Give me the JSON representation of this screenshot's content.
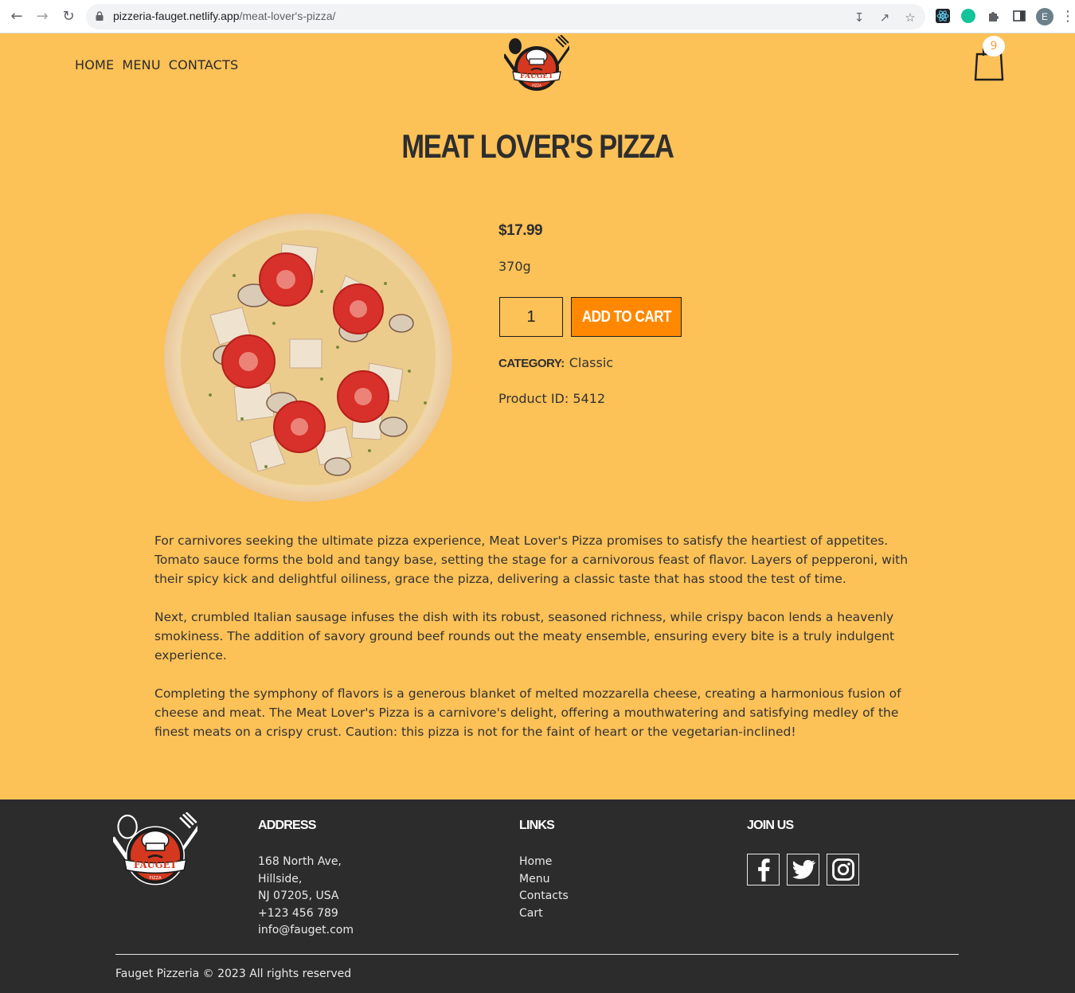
{
  "browser": {
    "url_host": "pizzeria-fauget.netlify.app",
    "url_path": "/meat-lover's-pizza/",
    "profile_initial": "E"
  },
  "nav": {
    "items": [
      {
        "label": "HOME"
      },
      {
        "label": "MENU"
      },
      {
        "label": "CONTACTS"
      }
    ]
  },
  "logo": {
    "brand_text": "FAUGET",
    "sub_text": "PIZZA"
  },
  "cart": {
    "count": "9"
  },
  "product": {
    "title": "MEAT LOVER'S PIZZA",
    "price": "$17.99",
    "weight": "370g",
    "quantity": "1",
    "add_to_cart_label": "ADD TO CART",
    "category_label": "CATEGORY:",
    "category_value": "Classic",
    "product_id": "Product ID: 5412",
    "description": [
      "For carnivores seeking the ultimate pizza experience, Meat Lover's Pizza promises to satisfy the heartiest of appetites. Tomato sauce forms the bold and tangy base, setting the stage for a carnivorous feast of flavor. Layers of pepperoni, with their spicy kick and delightful oiliness, grace the pizza, delivering a classic taste that has stood the test of time.",
      "Next, crumbled Italian sausage infuses the dish with its robust, seasoned richness, while crispy bacon lends a heavenly smokiness. The addition of savory ground beef rounds out the meaty ensemble, ensuring every bite is a truly indulgent experience.",
      "Completing the symphony of flavors is a generous blanket of melted mozzarella cheese, creating a harmonious fusion of cheese and meat. The Meat Lover's Pizza is a carnivore's delight, offering a mouthwatering and satisfying medley of the finest meats on a crispy crust. Caution: this pizza is not for the faint of heart or the vegetarian-inclined!"
    ]
  },
  "footer": {
    "address_heading": "ADDRESS",
    "address_lines": [
      "168 North Ave,",
      "Hillside,",
      "NJ 07205, USA",
      "+123 456 789",
      "info@fauget.com"
    ],
    "links_heading": "LINKS",
    "links": [
      "Home",
      "Menu",
      "Contacts",
      "Cart"
    ],
    "join_heading": "JOIN US",
    "social": [
      "facebook-icon",
      "twitter-icon",
      "instagram-icon"
    ],
    "copyright": "Fauget Pizzeria © 2023 All rights reserved"
  },
  "colors": {
    "page_bg": "#fcc157",
    "accent_button": "#ff8800",
    "footer_bg": "#2c2c2c"
  }
}
